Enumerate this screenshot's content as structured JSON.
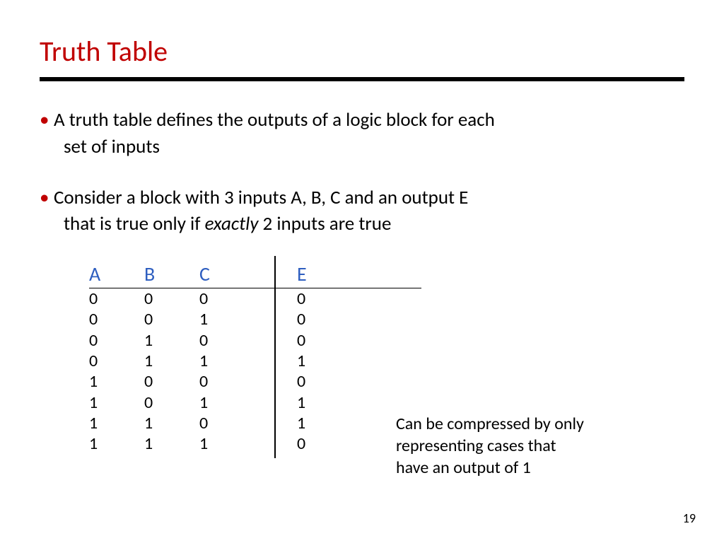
{
  "title": "Truth Table",
  "bullets": {
    "b1_line1": "A truth table defines the outputs of a logic block for each",
    "b1_line2": "set of inputs",
    "b2_line1": "Consider a block with 3 inputs A, B, C and an output E",
    "b2_line2_pre": "that is true only if ",
    "b2_line2_em": "exactly",
    "b2_line2_post": " 2 inputs are true"
  },
  "dot": "•",
  "table": {
    "headers": {
      "A": "A",
      "B": "B",
      "C": "C",
      "E": "E"
    }
  },
  "chart_data": {
    "type": "table",
    "columns": [
      "A",
      "B",
      "C",
      "E"
    ],
    "rows": [
      [
        "0",
        "0",
        "0",
        "0"
      ],
      [
        "0",
        "0",
        "1",
        "0"
      ],
      [
        "0",
        "1",
        "0",
        "0"
      ],
      [
        "0",
        "1",
        "1",
        "1"
      ],
      [
        "1",
        "0",
        "0",
        "0"
      ],
      [
        "1",
        "0",
        "1",
        "1"
      ],
      [
        "1",
        "1",
        "0",
        "1"
      ],
      [
        "1",
        "1",
        "1",
        "0"
      ]
    ]
  },
  "note_l1": "Can be compressed by only",
  "note_l2": "representing cases that",
  "note_l3": "have an output of 1",
  "page": "19"
}
